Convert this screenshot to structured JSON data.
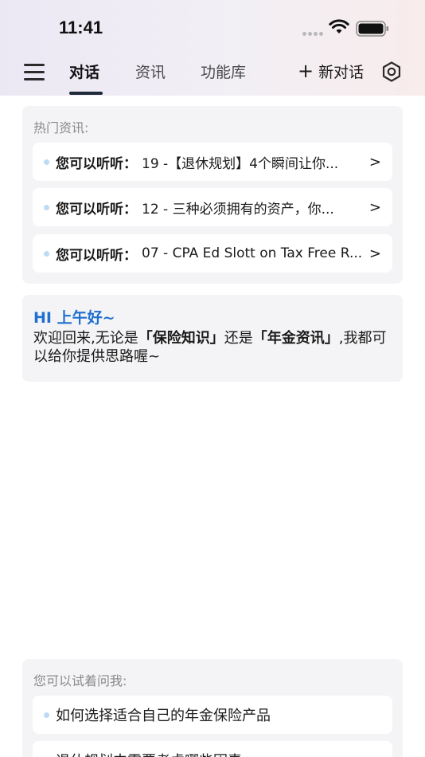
{
  "status": {
    "time": "11:41"
  },
  "header": {
    "tabs": [
      {
        "label": "对话",
        "active": true
      },
      {
        "label": "资讯",
        "active": false
      },
      {
        "label": "功能库",
        "active": false
      }
    ],
    "new_chat_label": "新对话"
  },
  "hot_news": {
    "title": "热门资讯:",
    "prefix": "您可以听听：",
    "items": [
      {
        "text": "19 -【退休规划】4个瞬间让你..."
      },
      {
        "text": "12 - 三种必须拥有的资产，你..."
      },
      {
        "text": "07 - CPA Ed Slott on Tax Free R..."
      }
    ]
  },
  "greeting": {
    "title": "HI 上午好~",
    "part1": "欢迎回来,无论是",
    "highlight1": "「保险知识」",
    "part2": "还是",
    "highlight2": "「年金资讯」",
    "part3": ",我都可以给你提供思路喔~"
  },
  "ask": {
    "title": "您可以试着问我:",
    "items": [
      {
        "text": "如何选择适合自己的年金保险产品"
      },
      {
        "text": "退休规划中需要考虑哪些因素"
      }
    ]
  },
  "colors": {
    "accent": "#1f6fd0",
    "card_bg": "#f4f4f6",
    "dot": "#bfdaf5"
  }
}
